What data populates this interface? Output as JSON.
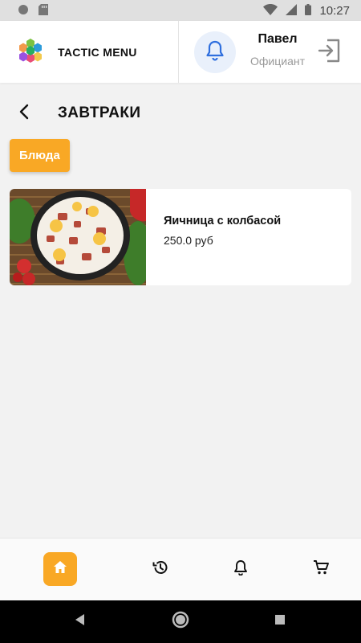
{
  "status_bar": {
    "time": "10:27",
    "icons": [
      "notification-dot-icon",
      "sd-card-icon",
      "wifi-icon",
      "signal-icon",
      "battery-icon"
    ]
  },
  "header": {
    "brand_name": "TACTIC MENU",
    "logo_icon": "hexagon-cluster-logo",
    "user_name": "Павел",
    "user_role": "Официант",
    "notification_icon": "bell-icon",
    "logout_icon": "logout-icon"
  },
  "section": {
    "back_icon": "chevron-left-icon",
    "title": "ЗАВТРАКИ"
  },
  "category_chip": {
    "label": "Блюда"
  },
  "dishes": [
    {
      "name": "Яичница с колбасой",
      "price": "250.0 руб",
      "image": "fried-eggs-with-sausage-photo"
    }
  ],
  "bottom_nav": {
    "items": [
      {
        "icon": "home-icon",
        "active": true
      },
      {
        "icon": "history-icon",
        "active": false
      },
      {
        "icon": "bell-icon",
        "active": false
      },
      {
        "icon": "cart-icon",
        "active": false
      }
    ]
  },
  "colors": {
    "accent": "#f9a825",
    "bell_background": "#e9f0fb",
    "bell_icon": "#2f6fde",
    "page_background": "#f2f2f2"
  }
}
